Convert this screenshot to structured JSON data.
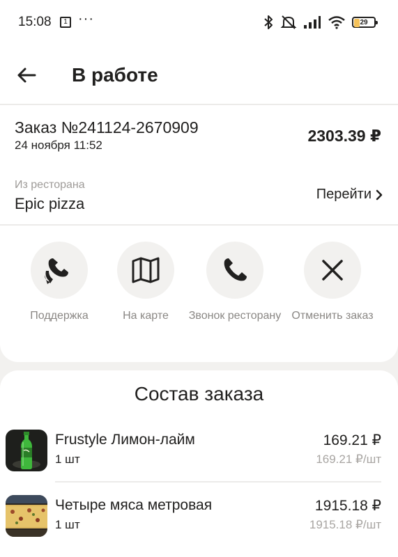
{
  "status_bar": {
    "time": "15:08",
    "notif_badge": "1",
    "dots": "···",
    "battery": "29",
    "battery_level": 0.29,
    "battery_color": "#f5c25a"
  },
  "header": {
    "title": "В работе",
    "back_icon": "arrow-left-icon"
  },
  "order": {
    "number": "Заказ №241124-2670909",
    "date": "24 ноября 11:52",
    "total": "2303.39 ₽"
  },
  "restaurant": {
    "caption": "Из ресторана",
    "name": "Epic pizza",
    "goto_label": "Перейти"
  },
  "actions": [
    {
      "label": "Поддержка",
      "icon": "support-phone-icon"
    },
    {
      "label": "На карте",
      "icon": "map-icon"
    },
    {
      "label": "Звонок ресторану",
      "icon": "phone-icon"
    },
    {
      "label": "Отменить заказ",
      "icon": "close-icon"
    }
  ],
  "composition": {
    "title": "Состав заказа",
    "items": [
      {
        "name": "Frustyle Лимон-лайм",
        "qty": "1 шт",
        "price": "169.21 ₽",
        "unit_price": "169.21 ₽/шт",
        "image": "green-bottle-image"
      },
      {
        "name": "Четыре мяса метровая",
        "qty": "1 шт",
        "price": "1915.18 ₽",
        "unit_price": "1915.18 ₽/шт",
        "image": "meter-pizza-image"
      }
    ]
  },
  "colors": {
    "background": "#f2f1ef",
    "card": "#ffffff",
    "text": "#21201f",
    "muted": "#9e9b98"
  }
}
